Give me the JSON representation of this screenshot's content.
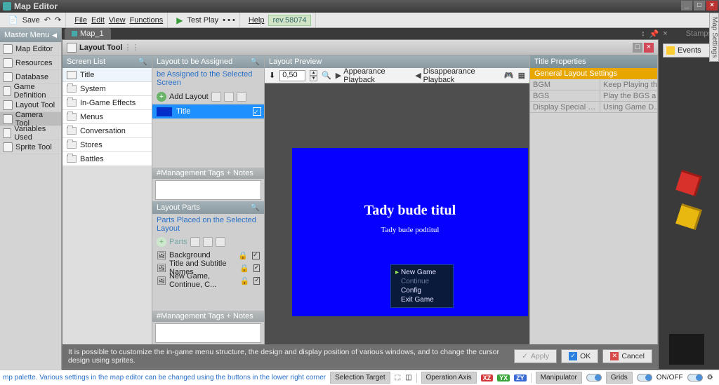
{
  "app": {
    "title": "Map Editor"
  },
  "win_buttons": {
    "min": "_",
    "max": "□",
    "close": "×"
  },
  "menu": {
    "save": "Save",
    "file": "File",
    "edit": "Edit",
    "view": "View",
    "functions": "Functions",
    "testplay": "Test Play",
    "dots": "• • •",
    "help": "Help",
    "rev": "rev.58074"
  },
  "master": {
    "head": "Master Menu",
    "items": [
      {
        "label": "Map Editor"
      },
      {
        "label": "Resources"
      },
      {
        "label": "Database"
      },
      {
        "label": "Game Definition"
      },
      {
        "label": "Layout Tool"
      },
      {
        "label": "Camera Tool",
        "sel": true
      },
      {
        "label": "Variables Used"
      },
      {
        "label": "Sprite Tool"
      }
    ]
  },
  "tabs": {
    "map1": "Map_1",
    "stamps": "Stamps"
  },
  "dialog": {
    "title": "Layout Tool",
    "screen_list": {
      "head": "Screen List",
      "title_item": "Title",
      "folders": [
        "System",
        "In-Game Effects",
        "Menus",
        "Conversation",
        "Stores",
        "Battles"
      ]
    },
    "assign": {
      "head": "Layout to be Assigned",
      "link": "be Assigned to the Selected Screen",
      "add": "Add Layout",
      "item": "Title",
      "sub1": "#Management Tags + Notes",
      "parts_head": "Layout Parts",
      "parts_link": "Parts Placed on the Selected Layout",
      "parts_add": "Parts",
      "parts": [
        "Background",
        "Title and Subtitle Names",
        "New Game, Continue, C..."
      ],
      "sub2": "#Management Tags + Notes"
    },
    "preview": {
      "head": "Layout Preview",
      "zoom": "0,50",
      "apb": "Appearance Playback",
      "dpb": "Disappearance Playback",
      "title": "Tady bude titul",
      "subtitle": "Tady bude podtitul",
      "menu": [
        "New Game",
        "Continue",
        "Config",
        "Exit Game"
      ]
    },
    "props": {
      "head": "Title Properties",
      "gold": "General Layout Settings",
      "rows": [
        {
          "k": "BGM",
          "v": "Keep Playing th"
        },
        {
          "k": "BGS",
          "v": "Play the BGS a"
        },
        {
          "k": "Display Special Format f...",
          "v": "Using Game D..."
        }
      ]
    },
    "hint": "It is possible to customize the in-game menu structure, the design and display position of various windows, and to change the cursor design using sprites.",
    "btns": {
      "apply": "Apply",
      "ok": "OK",
      "cancel": "Cancel"
    }
  },
  "right": {
    "events": "Events",
    "vtab": "Map Settings"
  },
  "status": {
    "blue": "mp palette.  Various settings in the map editor can be changed using the buttons in the lower right corner",
    "seltgt": "Selection Target",
    "opaxis": "Operation Axis",
    "xz": "XZ",
    "yx": "YX",
    "zy": "ZY",
    "manip": "Manipulator",
    "grids": "Grids",
    "onoff": "ON/OFF"
  }
}
